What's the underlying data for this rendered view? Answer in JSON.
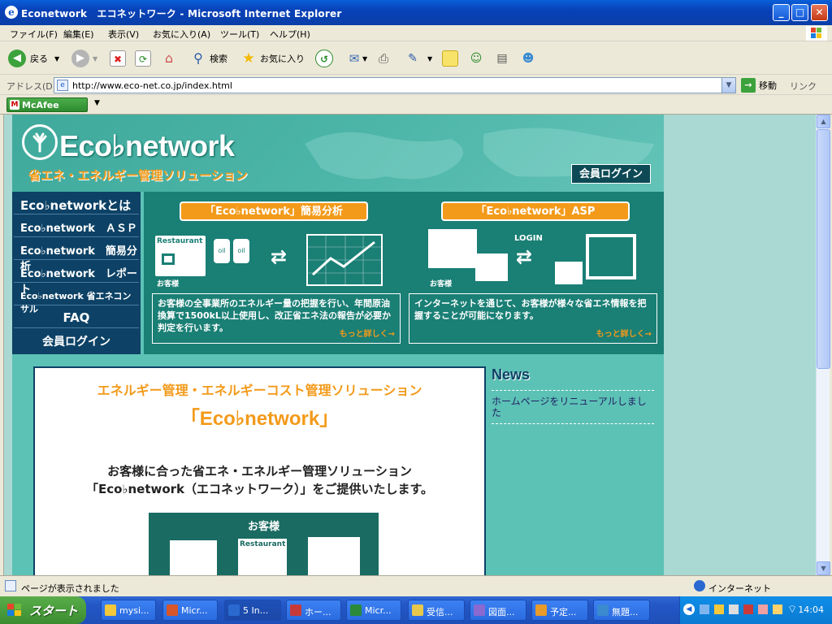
{
  "window": {
    "title": "Econetwork　エコネットワーク - Microsoft Internet Explorer",
    "minimize": "_",
    "maximize": "□",
    "close": "✕"
  },
  "menu": [
    "ファイル(F)",
    "編集(E)",
    "表示(V)",
    "お気に入り(A)",
    "ツール(T)",
    "ヘルプ(H)"
  ],
  "toolbar": {
    "back_label": "戻る",
    "search_label": "検索",
    "favorites_label": "お気に入り"
  },
  "address": {
    "label": "アドレス(D)",
    "url": "http://www.eco-net.co.jp/index.html",
    "go_label": "移動",
    "links_label": "リンク"
  },
  "mcafee": {
    "label": "McAfee"
  },
  "site": {
    "logo_text": "Eco♭network",
    "logo_sub": "省エネ・エネルギー管理ソリューション",
    "login_top": "会員ログイン",
    "nav": [
      "Eco♭networkとは",
      "Eco♭network　ＡＳＰ",
      "Eco♭network　簡易分析",
      "Eco♭network　レポート",
      "Eco♭network 省エネコンサル",
      "FAQ",
      "会員ログイン"
    ],
    "panel_left": {
      "title": "「Eco♭network」簡易分析",
      "caption_customer": "お客様",
      "icon_restaurant": "Restaurant",
      "icon_oil": "oil",
      "text": "お客様の全事業所のエネルギー量の把握を行い、年間原油換算で1500kL以上使用し、改正省エネ法の報告が必要か判定を行います。",
      "more": "もっと詳しく→"
    },
    "panel_right": {
      "title": "「Eco♭network」ASP",
      "caption_customer": "お客様",
      "login_label": "LOGIN",
      "text": "インターネットを通じて、お客様が様々な省エネ情報を把握することが可能になります。",
      "more": "もっと詳しく→"
    },
    "main": {
      "subtitle": "エネルギー管理・エネルギーコスト管理ソリューション",
      "title": "「Eco♭network」",
      "desc1": "お客様に合った省エネ・エネルギー管理ソリューション",
      "desc2": "「Eco♭network（エコネットワーク）」をご提供いたします。",
      "diagram_title": "お客様",
      "diagram_restaurant": "Restaurant"
    },
    "news": {
      "heading": "News",
      "item": "ホームページをリニューアルしました"
    }
  },
  "status": {
    "text": "ページが表示されました",
    "zone": "インターネット"
  },
  "taskbar": {
    "start": "スタート",
    "tasks": [
      "mysi...",
      "Micr...",
      "5 In...",
      "ホー...",
      "Micr...",
      "受信...",
      "図面...",
      "予定...",
      "無題..."
    ],
    "clock": "14:04"
  }
}
